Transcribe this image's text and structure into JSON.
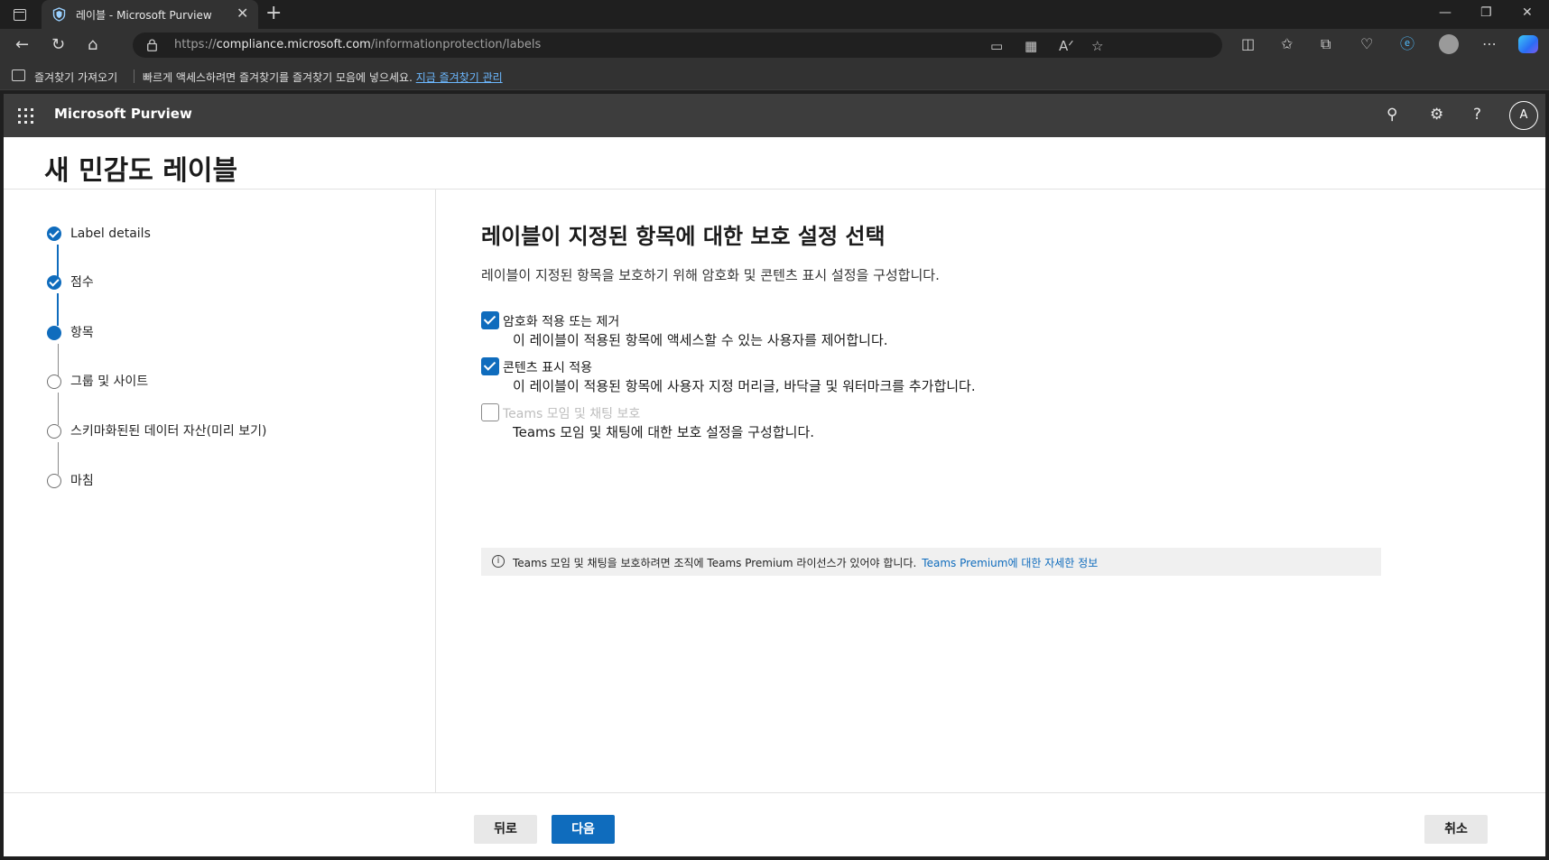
{
  "browser": {
    "tab_title": "레이블 - Microsoft Purview",
    "url_prefix": "https://",
    "url_host": "compliance.microsoft.com",
    "url_path": "/informationprotection/labels",
    "favorites_bar": {
      "import_label": "즐겨찾기 가져오기",
      "hint_text": "빠르게 액세스하려면 즐겨찾기를 즐겨찾기 모음에 넣으세요.",
      "manage_link": "지금 즐겨찾기 관리"
    }
  },
  "app": {
    "name": "Microsoft Purview",
    "user_initial": "A"
  },
  "page": {
    "title": "새 민감도 레이블"
  },
  "steps": [
    {
      "label": "Label details",
      "state": "done"
    },
    {
      "label": "점수",
      "state": "done"
    },
    {
      "label": "항목",
      "state": "current"
    },
    {
      "label": "그룹 및 사이트",
      "state": "todo"
    },
    {
      "label": "스키마화된된 데이터 자산(미리 보기)",
      "state": "todo"
    },
    {
      "label": "마침",
      "state": "todo"
    }
  ],
  "main": {
    "heading": "레이블이 지정된 항목에 대한 보호 설정 선택",
    "description": "레이블이 지정된 항목을 보호하기 위해 암호화 및 콘텐츠 표시 설정을 구성합니다.",
    "options": [
      {
        "label": "암호화 적용 또는 제거",
        "description": "이 레이블이 적용된 항목에 액세스할 수 있는 사용자를 제어합니다.",
        "checked": true,
        "disabled": false
      },
      {
        "label": "콘텐츠 표시 적용",
        "description": "이 레이블이 적용된 항목에 사용자 지정 머리글, 바닥글 및 워터마크를 추가합니다.",
        "checked": true,
        "disabled": false
      },
      {
        "label": "Teams 모임 및 채팅 보호",
        "description": "Teams 모임 및 채팅에 대한 보호 설정을 구성합니다.",
        "checked": false,
        "disabled": true
      }
    ],
    "info": {
      "text": "Teams 모임 및 채팅을 보호하려면 조직에 Teams Premium 라이선스가 있어야 합니다.",
      "link": "Teams Premium에 대한 자세한 정보"
    }
  },
  "footer": {
    "back_label": "뒤로",
    "next_label": "다음",
    "cancel_label": "취소"
  },
  "colors": {
    "accent": "#0f6cbd",
    "header_bg": "#3d3d3d"
  }
}
